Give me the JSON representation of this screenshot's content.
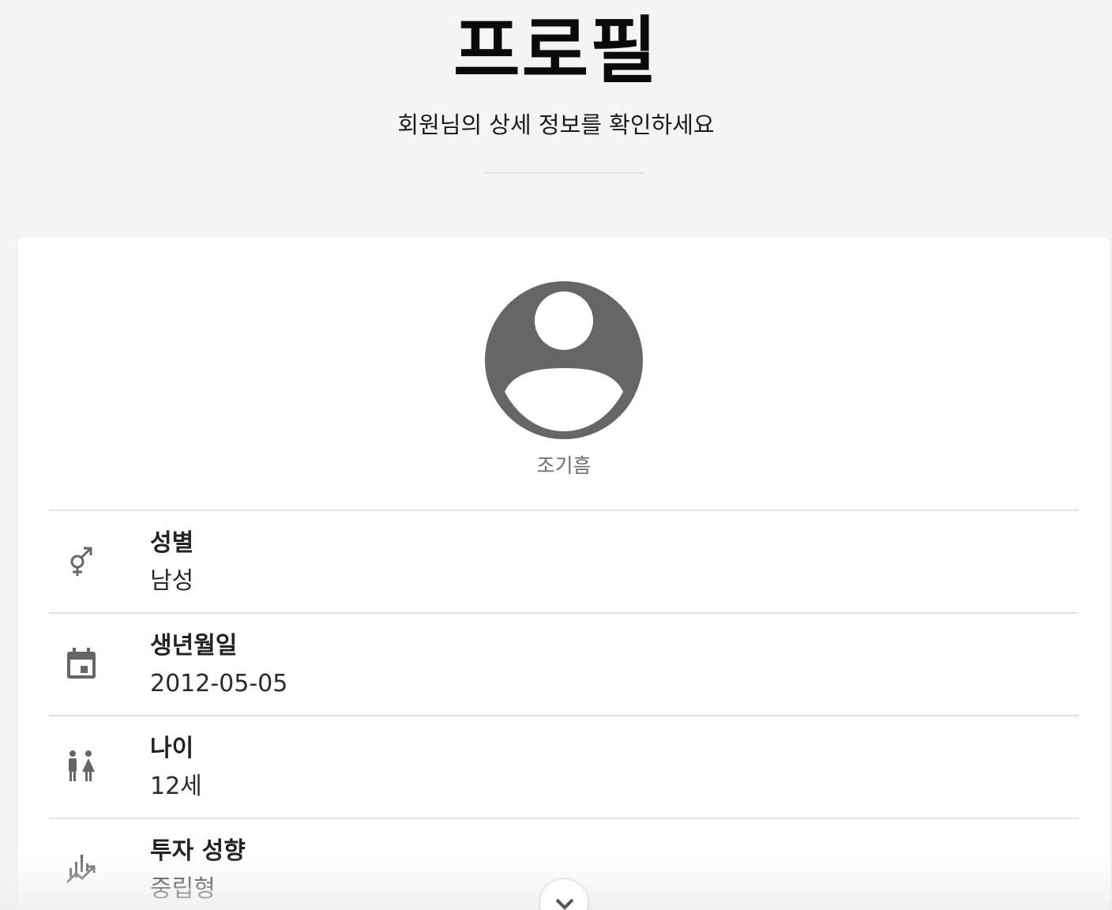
{
  "header": {
    "title": "프로필",
    "subtitle": "회원님의 상세 정보를 확인하세요"
  },
  "profile": {
    "avatar_icon": "account-circle-icon",
    "name": "조기흠"
  },
  "info": [
    {
      "icon": "male-female-icon",
      "label": "성별",
      "value": "남성"
    },
    {
      "icon": "calendar-icon",
      "label": "생년월일",
      "value": "2012-05-05"
    },
    {
      "icon": "wc-people-icon",
      "label": "나이",
      "value": "12세"
    },
    {
      "icon": "trending-chart-icon",
      "label": "투자 성향",
      "value": "중립형"
    }
  ],
  "scroll_button": {
    "icon": "chevron-down-icon"
  },
  "colors": {
    "background": "#f4f4f4",
    "card": "#ffffff",
    "icon": "#666666",
    "divider": "#e3e3e3"
  }
}
